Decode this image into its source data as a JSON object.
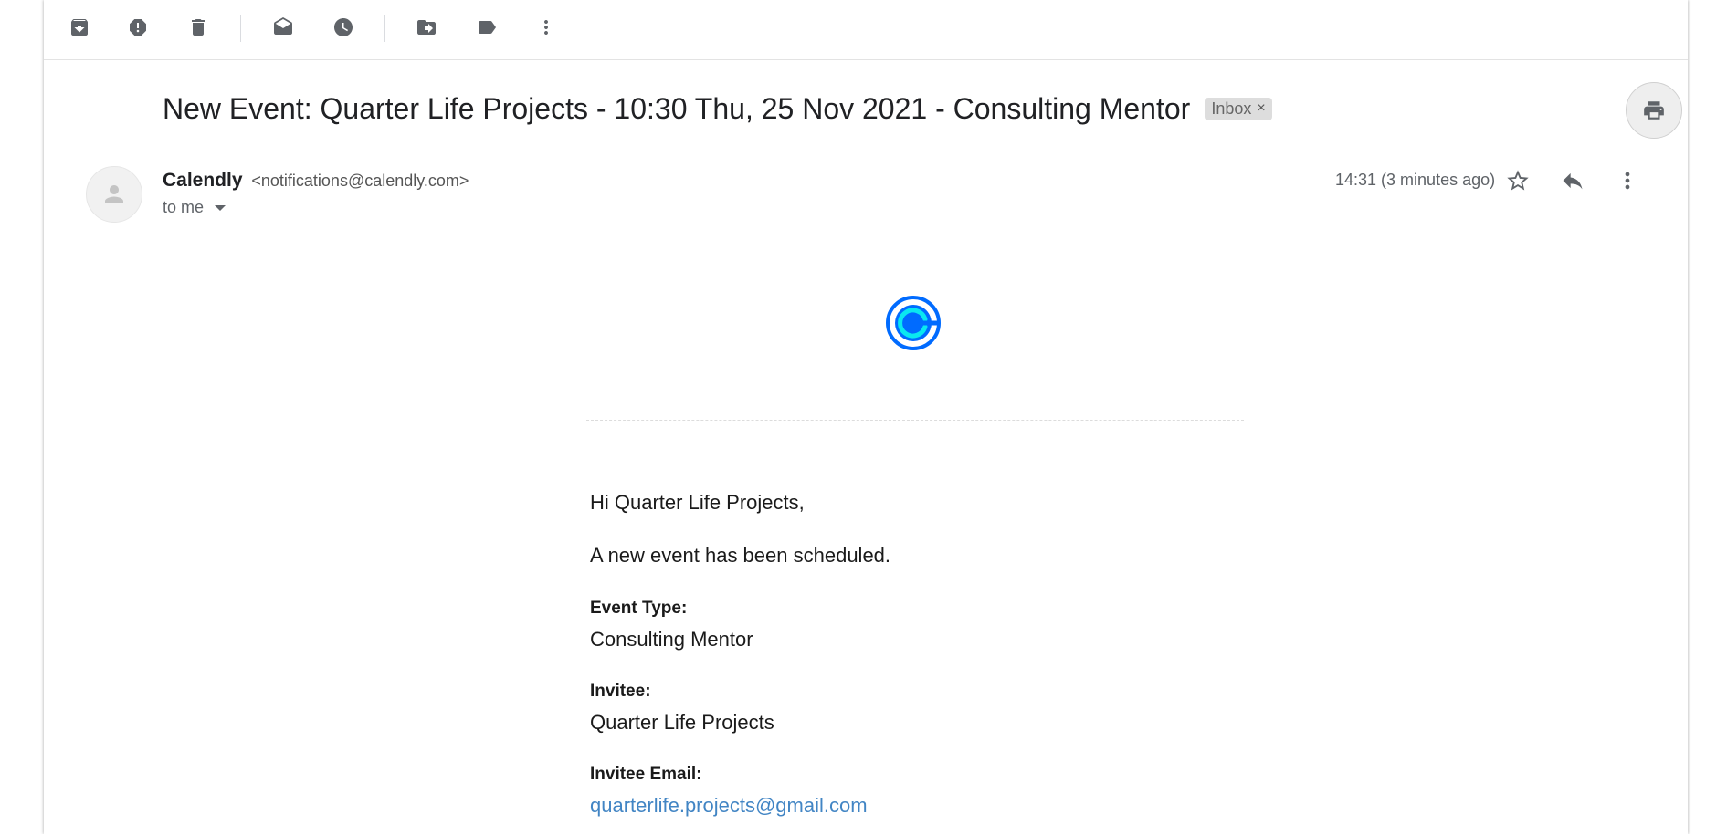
{
  "toolbar": {
    "icons": [
      "archive-icon",
      "report-spam-icon",
      "delete-icon",
      "mark-unread-icon",
      "snooze-icon",
      "move-to-icon",
      "label-icon",
      "more-vertical-icon"
    ]
  },
  "email": {
    "subject": "New Event: Quarter Life Projects - 10:30 Thu, 25 Nov 2021 - Consulting Mentor",
    "label_chip": "Inbox",
    "label_chip_close": "×",
    "sender_name": "Calendly",
    "sender_email": "<notifications@calendly.com>",
    "recipient": "to me",
    "timestamp": "14:31 (3 minutes ago)"
  },
  "message": {
    "greeting": "Hi Quarter Life Projects,",
    "intro": "A new event has been scheduled.",
    "fields": [
      {
        "label": "Event Type:",
        "value": "Consulting Mentor"
      },
      {
        "label": "Invitee:",
        "value": "Quarter Life Projects"
      },
      {
        "label": "Invitee Email:",
        "value": "quarterlife.projects@gmail.com"
      }
    ]
  },
  "colors": {
    "link": "#4285c4",
    "logo_blue": "#006bff",
    "logo_cyan": "#0ae8f0"
  }
}
